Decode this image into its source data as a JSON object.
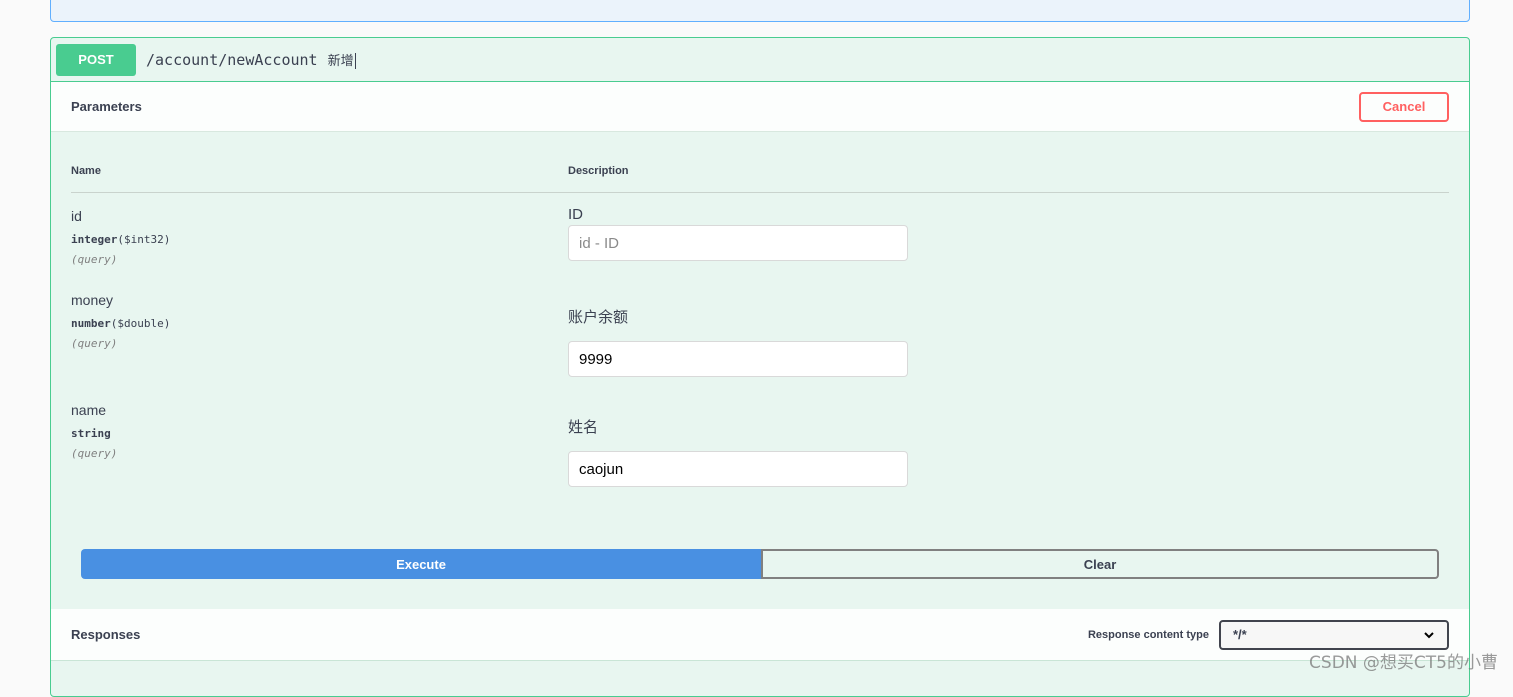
{
  "operation": {
    "method": "POST",
    "path": "/account/newAccount",
    "summary": "新增"
  },
  "parameters_section": {
    "title": "Parameters",
    "cancel_label": "Cancel",
    "col_name": "Name",
    "col_description": "Description"
  },
  "params": [
    {
      "name": "id",
      "type": "integer",
      "format": "($int32)",
      "in": "(query)",
      "description": "ID",
      "value": "",
      "placeholder": "id - ID"
    },
    {
      "name": "money",
      "type": "number",
      "format": "($double)",
      "in": "(query)",
      "description": "账户余额",
      "value": "9999",
      "placeholder": ""
    },
    {
      "name": "name",
      "type": "string",
      "format": "",
      "in": "(query)",
      "description": "姓名",
      "value": "caojun",
      "placeholder": ""
    }
  ],
  "actions": {
    "execute_label": "Execute",
    "clear_label": "Clear"
  },
  "responses_section": {
    "title": "Responses",
    "content_type_label": "Response content type",
    "content_type_value": "*/*"
  },
  "watermark": "CSDN @想买CT5的小曹",
  "colors": {
    "post": "#49cc90",
    "execute": "#4990e2",
    "cancel": "#ff6060"
  }
}
